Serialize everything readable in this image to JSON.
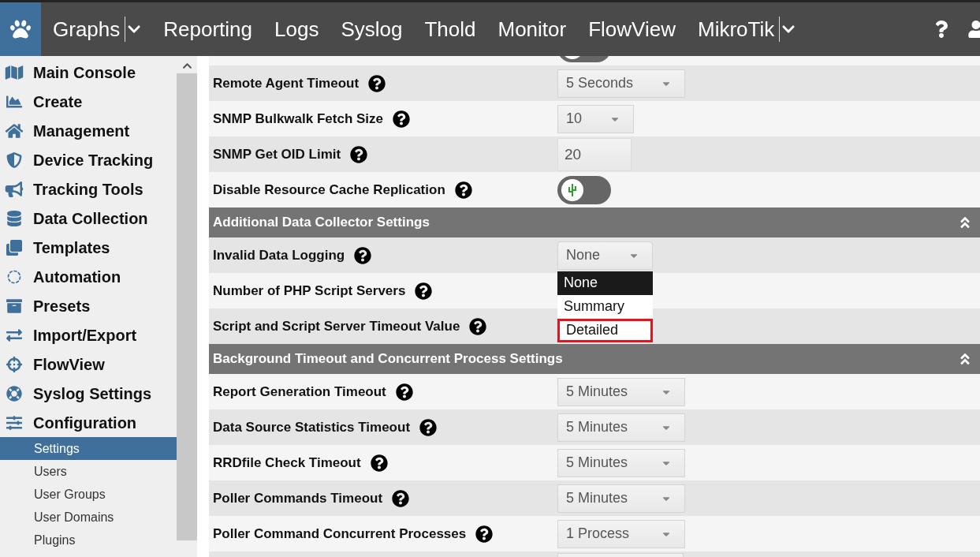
{
  "nav": {
    "menus": [
      {
        "label": "Graphs",
        "dropdown": true
      },
      {
        "label": "Reporting",
        "dropdown": false
      },
      {
        "label": "Logs",
        "dropdown": false
      },
      {
        "label": "Syslog",
        "dropdown": false
      },
      {
        "label": "Thold",
        "dropdown": false
      },
      {
        "label": "Monitor",
        "dropdown": false
      },
      {
        "label": "FlowView",
        "dropdown": false
      },
      {
        "label": "MikroTik",
        "dropdown": true
      }
    ]
  },
  "sidebar": {
    "items": [
      {
        "kind": "main",
        "label": "Main Console",
        "selected": false
      },
      {
        "kind": "main",
        "label": "Create",
        "selected": false
      },
      {
        "kind": "main",
        "label": "Management",
        "selected": false
      },
      {
        "kind": "main",
        "label": "Device Tracking",
        "selected": false
      },
      {
        "kind": "main",
        "label": "Tracking Tools",
        "selected": false
      },
      {
        "kind": "main",
        "label": "Data Collection",
        "selected": false
      },
      {
        "kind": "main",
        "label": "Templates",
        "selected": false
      },
      {
        "kind": "main",
        "label": "Automation",
        "selected": false
      },
      {
        "kind": "main",
        "label": "Presets",
        "selected": false
      },
      {
        "kind": "main",
        "label": "Import/Export",
        "selected": false
      },
      {
        "kind": "main",
        "label": "FlowView",
        "selected": false
      },
      {
        "kind": "main",
        "label": "Syslog Settings",
        "selected": false
      },
      {
        "kind": "main",
        "label": "Configuration",
        "selected": false
      },
      {
        "kind": "sub",
        "label": "Settings",
        "selected": true
      },
      {
        "kind": "sub",
        "label": "Users",
        "selected": false
      },
      {
        "kind": "sub",
        "label": "User Groups",
        "selected": false
      },
      {
        "kind": "sub",
        "label": "User Domains",
        "selected": false
      },
      {
        "kind": "sub",
        "label": "Plugins",
        "selected": false
      }
    ]
  },
  "settings": [
    {
      "kind": "toggle_partial",
      "on": false
    },
    {
      "kind": "select",
      "label": "Remote Agent Timeout",
      "value": "5 Seconds"
    },
    {
      "kind": "select",
      "label": "SNMP Bulkwalk Fetch Size",
      "value": "10"
    },
    {
      "kind": "input",
      "label": "SNMP Get OID Limit",
      "value": "20"
    },
    {
      "kind": "toggle",
      "label": "Disable Resource Cache Replication",
      "on": false
    },
    {
      "kind": "header",
      "label": "Additional Data Collector Settings"
    },
    {
      "kind": "select",
      "label": "Invalid Data Logging",
      "value": "None",
      "open": true,
      "options": [
        {
          "label": "None",
          "selected": true,
          "highlighted": false
        },
        {
          "label": "Summary",
          "selected": false,
          "highlighted": false
        },
        {
          "label": "Detailed",
          "selected": false,
          "highlighted": true
        }
      ]
    },
    {
      "kind": "covered",
      "label": "Number of PHP Script Servers"
    },
    {
      "kind": "covered",
      "label": "Script and Script Server Timeout Value"
    },
    {
      "kind": "header",
      "label": "Background Timeout and Concurrent Process Settings"
    },
    {
      "kind": "select",
      "label": "Report Generation Timeout",
      "value": "5 Minutes"
    },
    {
      "kind": "select",
      "label": "Data Source Statistics Timeout",
      "value": "5 Minutes"
    },
    {
      "kind": "select",
      "label": "RRDfile Check Timeout",
      "value": "5 Minutes"
    },
    {
      "kind": "select",
      "label": "Poller Commands Timeout",
      "value": "5 Minutes"
    },
    {
      "kind": "select",
      "label": "Poller Command Concurrent Processes",
      "value": "1 Process"
    },
    {
      "kind": "partial_select"
    }
  ]
}
